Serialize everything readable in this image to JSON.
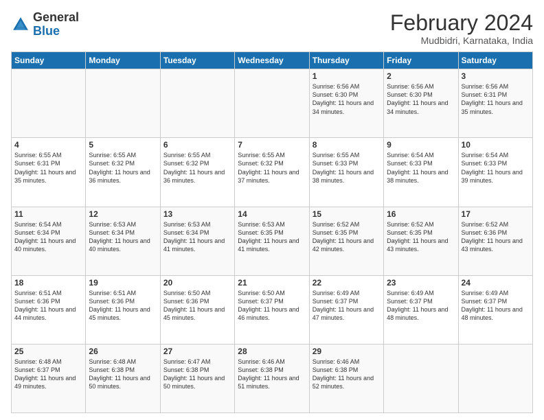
{
  "logo": {
    "general": "General",
    "blue": "Blue"
  },
  "header": {
    "title": "February 2024",
    "subtitle": "Mudbidri, Karnataka, India"
  },
  "weekdays": [
    "Sunday",
    "Monday",
    "Tuesday",
    "Wednesday",
    "Thursday",
    "Friday",
    "Saturday"
  ],
  "weeks": [
    [
      {
        "day": "",
        "info": ""
      },
      {
        "day": "",
        "info": ""
      },
      {
        "day": "",
        "info": ""
      },
      {
        "day": "",
        "info": ""
      },
      {
        "day": "1",
        "info": "Sunrise: 6:56 AM\nSunset: 6:30 PM\nDaylight: 11 hours and 34 minutes."
      },
      {
        "day": "2",
        "info": "Sunrise: 6:56 AM\nSunset: 6:30 PM\nDaylight: 11 hours and 34 minutes."
      },
      {
        "day": "3",
        "info": "Sunrise: 6:56 AM\nSunset: 6:31 PM\nDaylight: 11 hours and 35 minutes."
      }
    ],
    [
      {
        "day": "4",
        "info": "Sunrise: 6:55 AM\nSunset: 6:31 PM\nDaylight: 11 hours and 35 minutes."
      },
      {
        "day": "5",
        "info": "Sunrise: 6:55 AM\nSunset: 6:32 PM\nDaylight: 11 hours and 36 minutes."
      },
      {
        "day": "6",
        "info": "Sunrise: 6:55 AM\nSunset: 6:32 PM\nDaylight: 11 hours and 36 minutes."
      },
      {
        "day": "7",
        "info": "Sunrise: 6:55 AM\nSunset: 6:32 PM\nDaylight: 11 hours and 37 minutes."
      },
      {
        "day": "8",
        "info": "Sunrise: 6:55 AM\nSunset: 6:33 PM\nDaylight: 11 hours and 38 minutes."
      },
      {
        "day": "9",
        "info": "Sunrise: 6:54 AM\nSunset: 6:33 PM\nDaylight: 11 hours and 38 minutes."
      },
      {
        "day": "10",
        "info": "Sunrise: 6:54 AM\nSunset: 6:33 PM\nDaylight: 11 hours and 39 minutes."
      }
    ],
    [
      {
        "day": "11",
        "info": "Sunrise: 6:54 AM\nSunset: 6:34 PM\nDaylight: 11 hours and 40 minutes."
      },
      {
        "day": "12",
        "info": "Sunrise: 6:53 AM\nSunset: 6:34 PM\nDaylight: 11 hours and 40 minutes."
      },
      {
        "day": "13",
        "info": "Sunrise: 6:53 AM\nSunset: 6:34 PM\nDaylight: 11 hours and 41 minutes."
      },
      {
        "day": "14",
        "info": "Sunrise: 6:53 AM\nSunset: 6:35 PM\nDaylight: 11 hours and 41 minutes."
      },
      {
        "day": "15",
        "info": "Sunrise: 6:52 AM\nSunset: 6:35 PM\nDaylight: 11 hours and 42 minutes."
      },
      {
        "day": "16",
        "info": "Sunrise: 6:52 AM\nSunset: 6:35 PM\nDaylight: 11 hours and 43 minutes."
      },
      {
        "day": "17",
        "info": "Sunrise: 6:52 AM\nSunset: 6:36 PM\nDaylight: 11 hours and 43 minutes."
      }
    ],
    [
      {
        "day": "18",
        "info": "Sunrise: 6:51 AM\nSunset: 6:36 PM\nDaylight: 11 hours and 44 minutes."
      },
      {
        "day": "19",
        "info": "Sunrise: 6:51 AM\nSunset: 6:36 PM\nDaylight: 11 hours and 45 minutes."
      },
      {
        "day": "20",
        "info": "Sunrise: 6:50 AM\nSunset: 6:36 PM\nDaylight: 11 hours and 45 minutes."
      },
      {
        "day": "21",
        "info": "Sunrise: 6:50 AM\nSunset: 6:37 PM\nDaylight: 11 hours and 46 minutes."
      },
      {
        "day": "22",
        "info": "Sunrise: 6:49 AM\nSunset: 6:37 PM\nDaylight: 11 hours and 47 minutes."
      },
      {
        "day": "23",
        "info": "Sunrise: 6:49 AM\nSunset: 6:37 PM\nDaylight: 11 hours and 48 minutes."
      },
      {
        "day": "24",
        "info": "Sunrise: 6:49 AM\nSunset: 6:37 PM\nDaylight: 11 hours and 48 minutes."
      }
    ],
    [
      {
        "day": "25",
        "info": "Sunrise: 6:48 AM\nSunset: 6:37 PM\nDaylight: 11 hours and 49 minutes."
      },
      {
        "day": "26",
        "info": "Sunrise: 6:48 AM\nSunset: 6:38 PM\nDaylight: 11 hours and 50 minutes."
      },
      {
        "day": "27",
        "info": "Sunrise: 6:47 AM\nSunset: 6:38 PM\nDaylight: 11 hours and 50 minutes."
      },
      {
        "day": "28",
        "info": "Sunrise: 6:46 AM\nSunset: 6:38 PM\nDaylight: 11 hours and 51 minutes."
      },
      {
        "day": "29",
        "info": "Sunrise: 6:46 AM\nSunset: 6:38 PM\nDaylight: 11 hours and 52 minutes."
      },
      {
        "day": "",
        "info": ""
      },
      {
        "day": "",
        "info": ""
      }
    ]
  ]
}
